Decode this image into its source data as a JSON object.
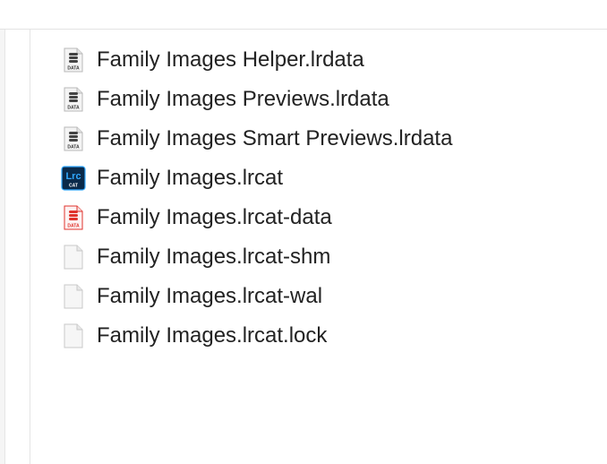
{
  "files": [
    {
      "name": "Family Images Helper.lrdata",
      "icon": "database-document-icon",
      "icon_label": "DATA"
    },
    {
      "name": "Family Images Previews.lrdata",
      "icon": "database-document-icon",
      "icon_label": "DATA"
    },
    {
      "name": "Family Images Smart Previews.lrdata",
      "icon": "database-document-icon",
      "icon_label": "DATA"
    },
    {
      "name": "Family Images.lrcat",
      "icon": "lightroom-catalog-icon",
      "icon_label": "Lrc",
      "icon_sublabel": "CAT"
    },
    {
      "name": "Family Images.lrcat-data",
      "icon": "red-database-document-icon",
      "icon_label": "DATA"
    },
    {
      "name": "Family Images.lrcat-shm",
      "icon": "blank-document-icon"
    },
    {
      "name": "Family Images.lrcat-wal",
      "icon": "blank-document-icon"
    },
    {
      "name": "Family Images.lrcat.lock",
      "icon": "blank-document-icon"
    }
  ],
  "colors": {
    "lrc_blue": "#0a2a4a",
    "lrc_accent": "#31a8ff",
    "data_red": "#e0332c",
    "text": "#222222"
  }
}
